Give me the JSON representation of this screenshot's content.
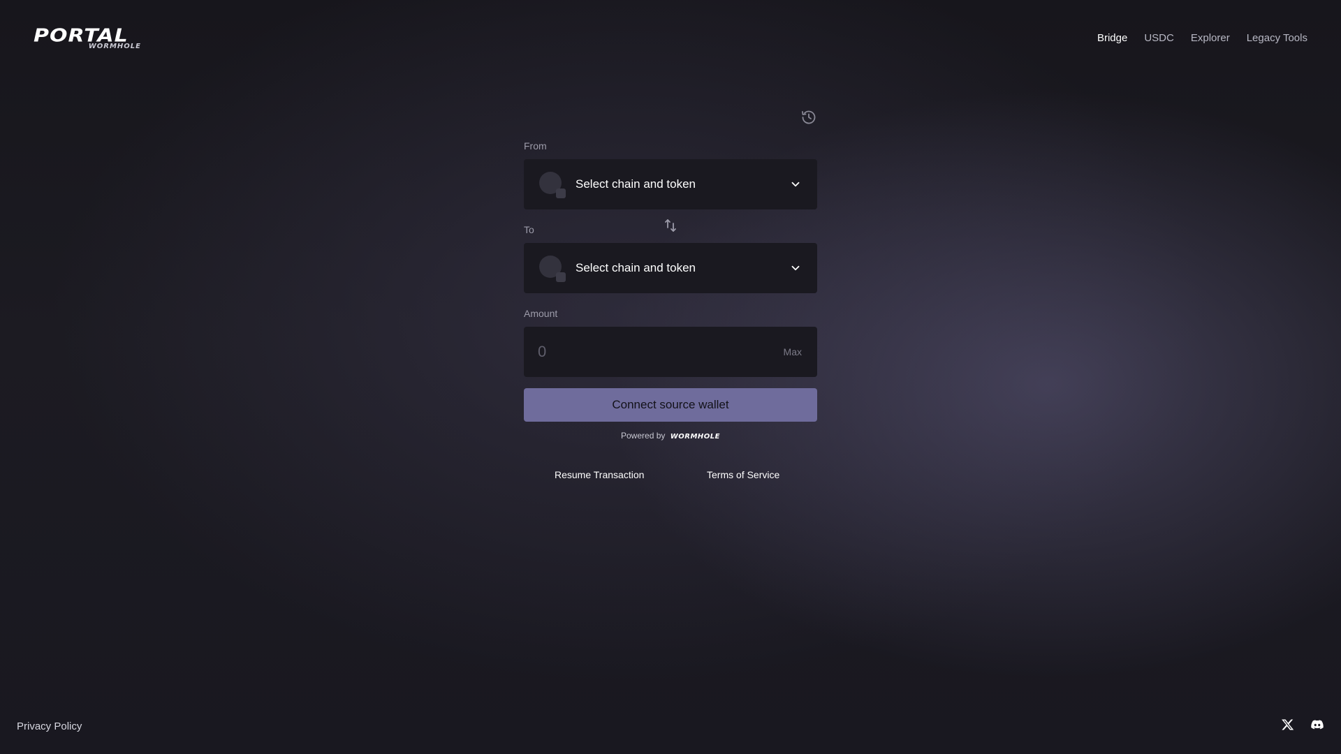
{
  "header": {
    "logo_main": "PORTAL",
    "logo_sub": "WORMHOLE",
    "nav": [
      {
        "label": "Bridge",
        "active": true
      },
      {
        "label": "USDC",
        "active": false
      },
      {
        "label": "Explorer",
        "active": false
      },
      {
        "label": "Legacy Tools",
        "active": false
      }
    ]
  },
  "form": {
    "from_label": "From",
    "from_placeholder": "Select chain and token",
    "to_label": "To",
    "to_placeholder": "Select chain and token",
    "amount_label": "Amount",
    "amount_placeholder": "0",
    "max_label": "Max",
    "connect_label": "Connect source wallet",
    "powered_by": "Powered by",
    "powered_brand": "WORMHOLE",
    "resume_label": "Resume Transaction",
    "tos_label": "Terms of Service"
  },
  "footer": {
    "privacy_label": "Privacy Policy",
    "social": [
      "x-icon",
      "discord-icon"
    ]
  },
  "colors": {
    "accent": "#6f6c9c",
    "field_bg": "#1a1920"
  }
}
